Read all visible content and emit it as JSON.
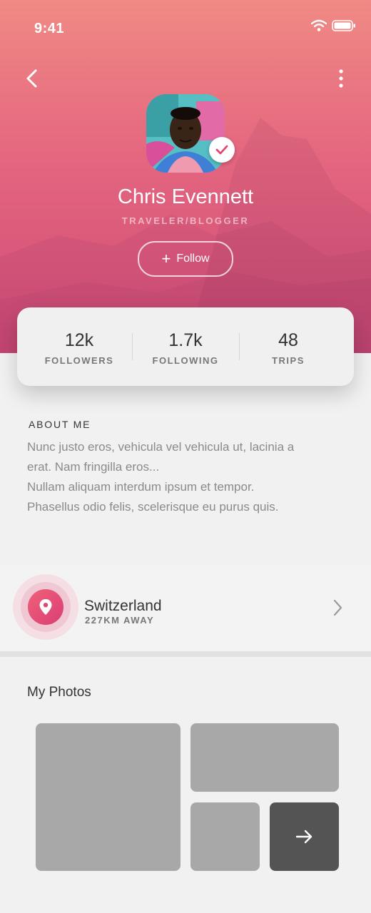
{
  "status_bar": {
    "time": "9:41"
  },
  "profile": {
    "name": "Chris Evennett",
    "role": "TRAVELER/BLOGGER",
    "follow_label": "Follow"
  },
  "stats": [
    {
      "value": "12k",
      "label": "FOLLOWERS"
    },
    {
      "value": "1.7k",
      "label": "FOLLOWING"
    },
    {
      "value": "48",
      "label": "TRIPS"
    }
  ],
  "about": {
    "title": "ABOUT ME",
    "lines": [
      "Nunc justo eros, vehicula vel vehicula ut, lacinia a",
      "erat. Nam fringilla eros...",
      "Nullam aliquam interdum ipsum et tempor.",
      "Phasellus odio felis, scelerisque eu purus quis."
    ]
  },
  "location": {
    "name": "Switzerland",
    "distance": "227KM AWAY"
  },
  "photos": {
    "title": "My Photos"
  },
  "colors": {
    "accent": "#e2486f",
    "header_top": "#f08a84",
    "header_bottom": "#cf4a78"
  },
  "icons": [
    "back-arrow-icon",
    "more-vertical-icon",
    "wifi-icon",
    "battery-icon",
    "verified-check-icon",
    "plus-icon",
    "location-pin-icon",
    "chevron-right-icon",
    "arrow-right-icon"
  ]
}
